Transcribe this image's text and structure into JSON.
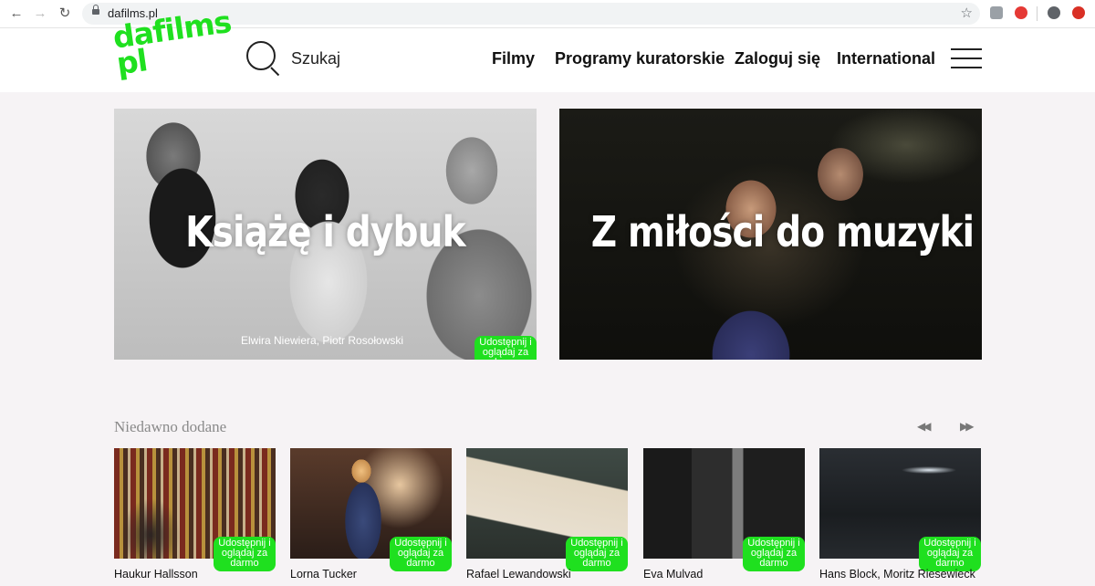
{
  "browser": {
    "url": "dafilms.pl"
  },
  "header": {
    "logo_lines": [
      "dafilms.",
      "pl"
    ],
    "search_label": "Szukaj",
    "menu": [
      "Filmy",
      "Programy kuratorskie",
      "Zaloguj się",
      "International"
    ]
  },
  "colors": {
    "accent_green": "#1fe01f"
  },
  "featured": [
    {
      "title": "Książę i dybuk",
      "credit": "Elwira Niewiera, Piotr Rosołowski",
      "badge": "Udostępnij i oglądaj za darmo"
    },
    {
      "title": "Z miłości do muzyki"
    }
  ],
  "recent": {
    "title": "Niedawno dodane",
    "badge": "Udostępnij i oglądaj za darmo",
    "items": [
      {
        "author": "Haukur Hallsson"
      },
      {
        "author": "Lorna Tucker"
      },
      {
        "author": "Rafael Lewandowski"
      },
      {
        "author": "Eva Mulvad"
      },
      {
        "author": "Hans Block, Moritz Riesewieck"
      }
    ]
  }
}
